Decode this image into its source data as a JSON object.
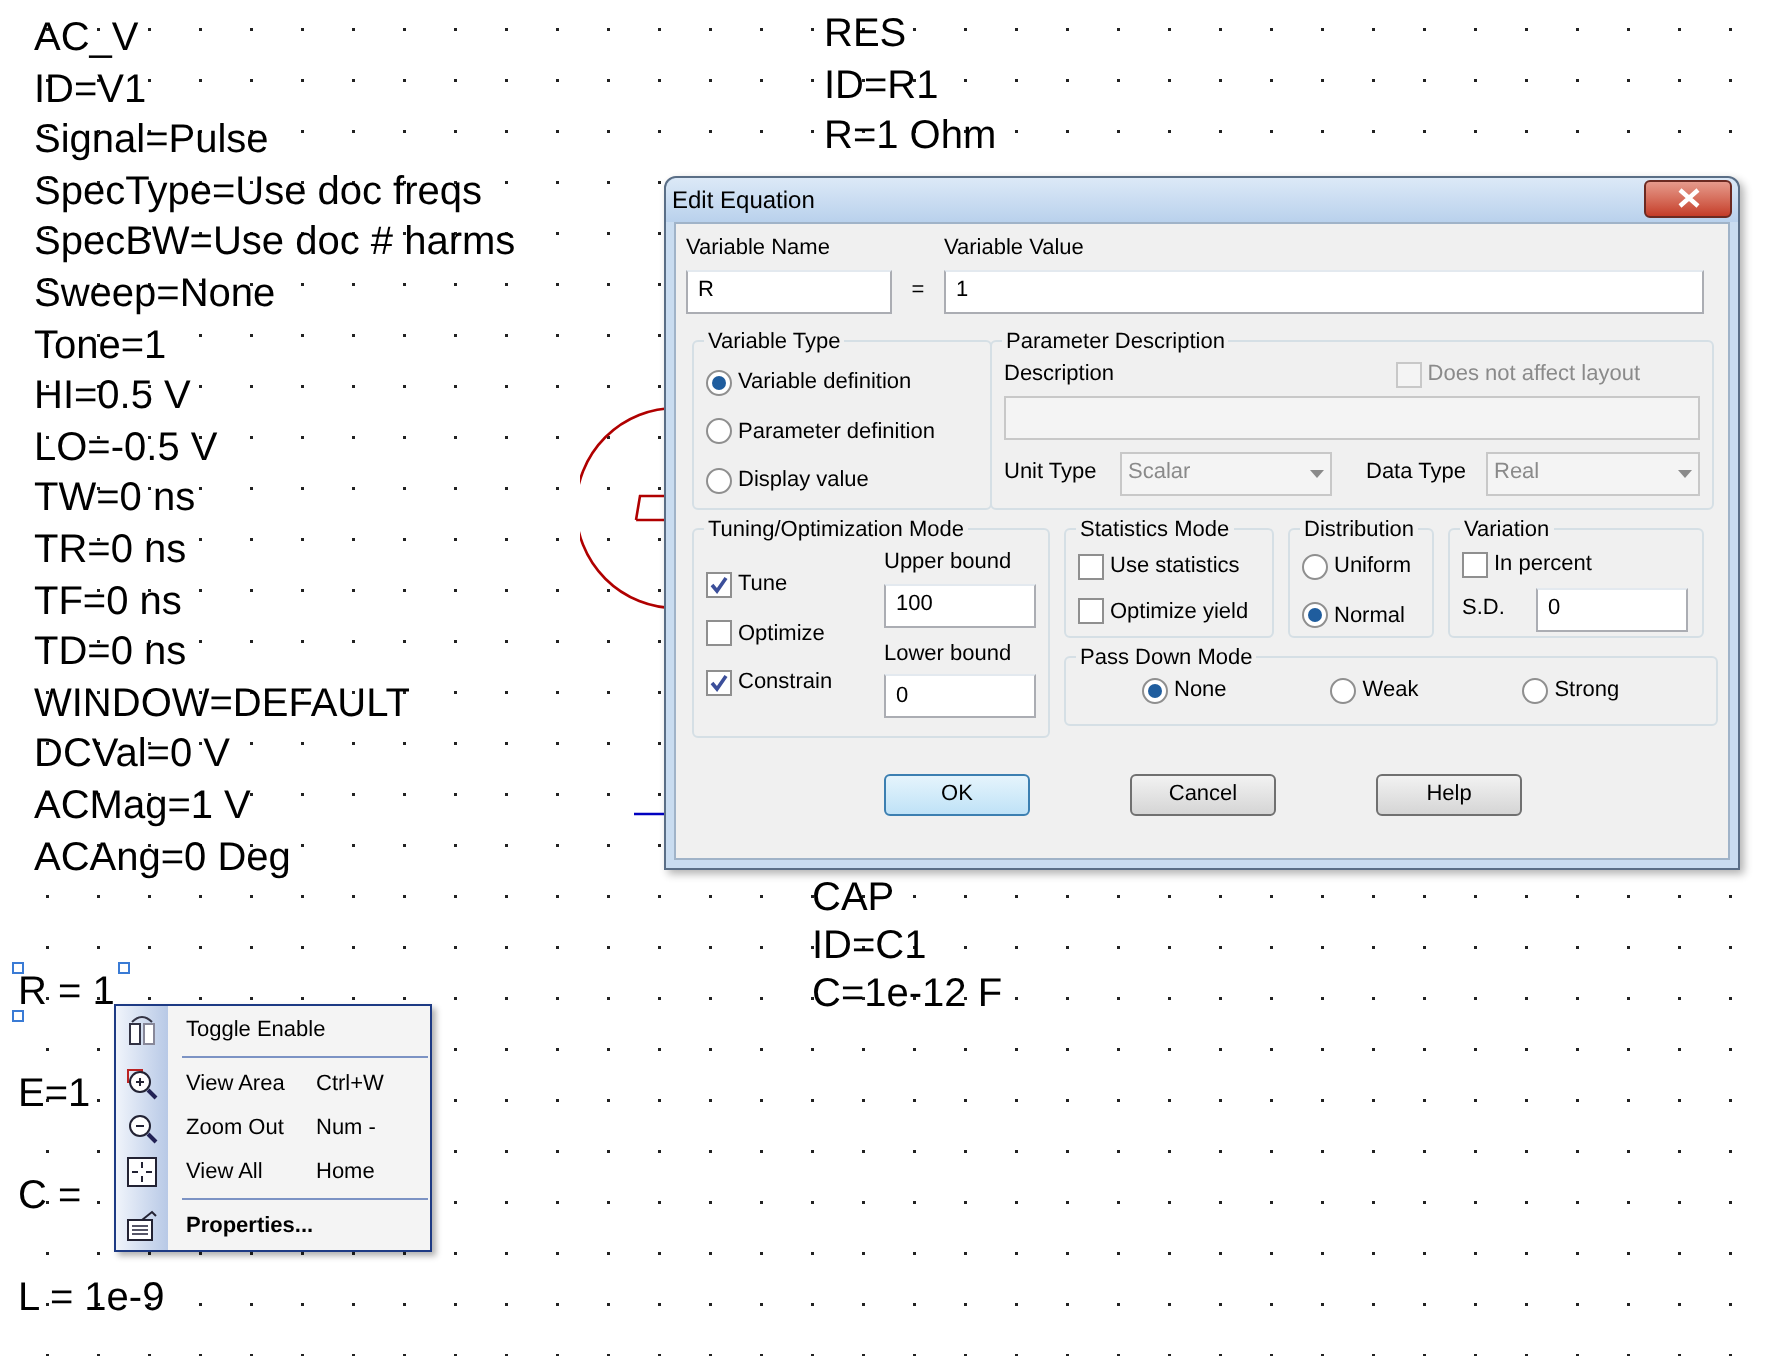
{
  "canvas": {
    "source_block": [
      "AC_V",
      "ID=V1",
      "Signal=Pulse",
      "SpecType=Use doc freqs",
      "SpecBW=Use doc # harms",
      "Sweep=None",
      "Tone=1",
      "HI=0.5 V",
      "LO=-0.5 V",
      "TW=0 ns",
      "TR=0 ns",
      "TF=0 ns",
      "TD=0 ns",
      "WINDOW=DEFAULT",
      "DCVal=0 V",
      "ACMag=1 V",
      "ACAng=0 Deg"
    ],
    "resistor_block": [
      "RES",
      "ID=R1",
      "R=1 Ohm"
    ],
    "capacitor_block": [
      "CAP",
      "ID=C1",
      "C=1e-12 F"
    ],
    "equations": [
      {
        "text": "R = 1",
        "selected": true
      },
      {
        "text": "E=1",
        "selected": false
      },
      {
        "text": "C =",
        "selected": false
      },
      {
        "text": "L = 1e-9",
        "selected": false
      }
    ]
  },
  "dialog": {
    "title": "Edit Equation",
    "variable_name": {
      "label": "Variable Name",
      "value": "R"
    },
    "equals": "=",
    "variable_value": {
      "label": "Variable Value",
      "value": "1"
    },
    "variable_type": {
      "title": "Variable Type",
      "options": [
        {
          "label": "Variable definition",
          "selected": true
        },
        {
          "label": "Parameter definition",
          "selected": false
        },
        {
          "label": "Display value",
          "selected": false
        }
      ]
    },
    "parameter_description": {
      "title": "Parameter Description",
      "layout_check": {
        "label": "Does not affect layout",
        "checked": false,
        "disabled": true
      },
      "description_label": "Description",
      "unit_type": {
        "label": "Unit Type",
        "value": "Scalar",
        "disabled": true
      },
      "data_type": {
        "label": "Data Type",
        "value": "Real",
        "disabled": true
      }
    },
    "tuning": {
      "title": "Tuning/Optimization Mode",
      "checks": [
        {
          "label": "Tune",
          "checked": true
        },
        {
          "label": "Optimize",
          "checked": false
        },
        {
          "label": "Constrain",
          "checked": true
        }
      ],
      "upper_bound": {
        "label": "Upper bound",
        "value": "100"
      },
      "lower_bound": {
        "label": "Lower bound",
        "value": "0"
      }
    },
    "statistics": {
      "title": "Statistics Mode",
      "checks": [
        {
          "label": "Use statistics",
          "checked": false
        },
        {
          "label": "Optimize yield",
          "checked": false
        }
      ]
    },
    "distribution": {
      "title": "Distribution",
      "options": [
        {
          "label": "Uniform",
          "selected": false
        },
        {
          "label": "Normal",
          "selected": true
        }
      ]
    },
    "variation": {
      "title": "Variation",
      "in_percent": {
        "label": "In percent",
        "checked": false
      },
      "sd": {
        "label": "S.D.",
        "value": "0"
      }
    },
    "pass_down": {
      "title": "Pass Down Mode",
      "options": [
        {
          "label": "None",
          "selected": true
        },
        {
          "label": "Weak",
          "selected": false
        },
        {
          "label": "Strong",
          "selected": false
        }
      ]
    },
    "buttons": [
      {
        "label": "OK",
        "default": true
      },
      {
        "label": "Cancel",
        "default": false
      },
      {
        "label": "Help",
        "default": false
      }
    ]
  },
  "context_menu": {
    "items": [
      {
        "kind": "item",
        "label": "Toggle Enable",
        "bold": false
      },
      {
        "kind": "separator"
      },
      {
        "kind": "item",
        "label": "View Area",
        "shortcut": "Ctrl+W",
        "bold": false
      },
      {
        "kind": "item",
        "label": "Zoom Out",
        "shortcut": "Num -",
        "bold": false
      },
      {
        "kind": "item",
        "label": "View All",
        "shortcut": "Home",
        "bold": false
      },
      {
        "kind": "separator"
      },
      {
        "kind": "item",
        "label": "Properties...",
        "bold": true
      }
    ]
  }
}
